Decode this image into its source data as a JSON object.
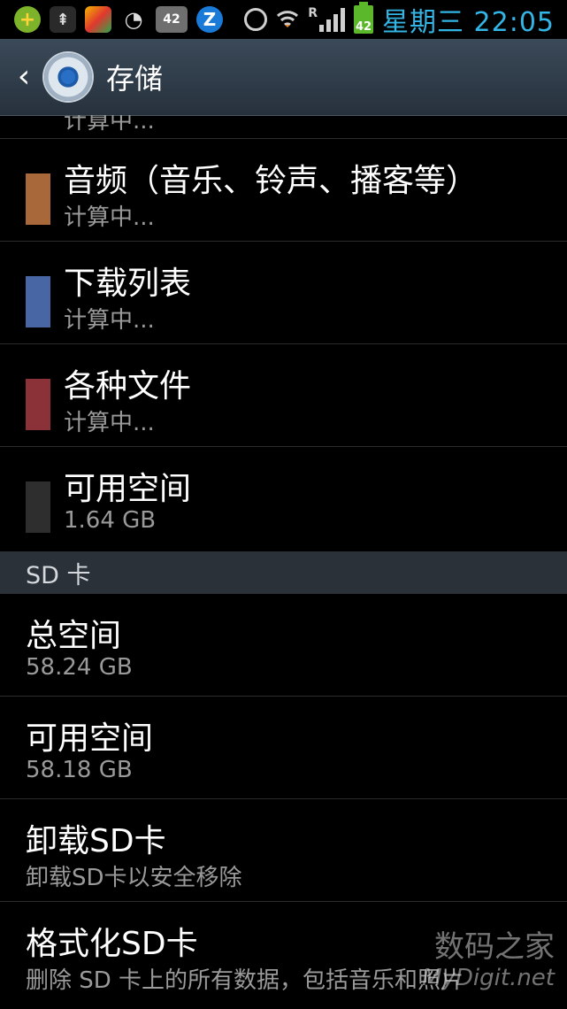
{
  "status_bar": {
    "icons": [
      "add-icon",
      "tree-icon",
      "browser-icon",
      "wechat-icon",
      "notification-42-icon",
      "z-app-icon"
    ],
    "icon_42_label": "42",
    "z_label": "Z",
    "roaming": "R",
    "battery_level": "42",
    "time": "星期三 22:05",
    "accent_color": "#33b5e5"
  },
  "action_bar": {
    "title": "存储"
  },
  "storage_internal": {
    "partial_item_text": "计算中...",
    "items": [
      {
        "title": "音频（音乐、铃声、播客等）",
        "subtitle": "计算中...",
        "color": "#a9683a"
      },
      {
        "title": "下载列表",
        "subtitle": "计算中...",
        "color": "#4866a3"
      },
      {
        "title": "各种文件",
        "subtitle": "计算中...",
        "color": "#8a3237"
      },
      {
        "title": "可用空间",
        "subtitle": "1.64 GB",
        "color": "#2e2e2e"
      }
    ]
  },
  "sd_section": {
    "header": "SD 卡",
    "items": [
      {
        "title": "总空间",
        "subtitle": "58.24 GB"
      },
      {
        "title": "可用空间",
        "subtitle": "58.18 GB"
      },
      {
        "title": "卸载SD卡",
        "subtitle": "卸载SD卡以安全移除"
      },
      {
        "title": "格式化SD卡",
        "subtitle": "删除 SD 卡上的所有数据，包括音乐和照片"
      }
    ]
  },
  "watermark": {
    "line1": "数码之家",
    "line2": "MyDigit.net"
  }
}
